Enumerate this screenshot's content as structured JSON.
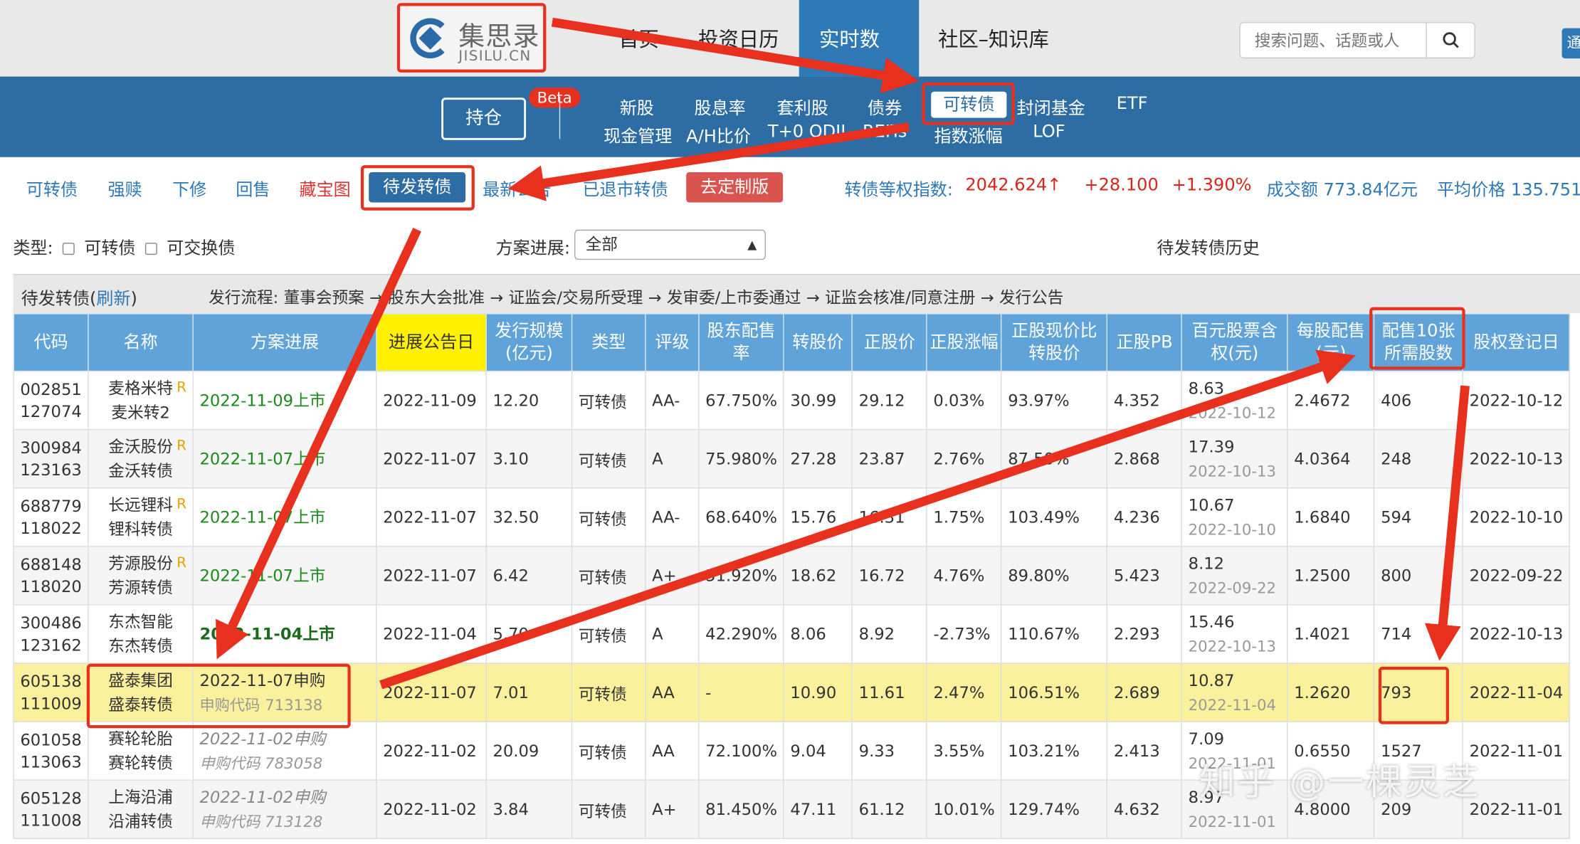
{
  "header": {
    "logo_cn": "集思录",
    "logo_en": "JISILU.CN",
    "nav": [
      "首页",
      "投资日历",
      "实时数据",
      "社区–知识库"
    ],
    "search_placeholder": "搜索问题、话题或人",
    "corner": "通"
  },
  "subnav": {
    "hold": "持仓",
    "beta": "Beta",
    "row1": [
      "新股",
      "股息率",
      "套利股",
      "债券",
      "可转债",
      "封闭基金",
      "ETF"
    ],
    "row2": [
      "现金管理",
      "A/H比价",
      "T+0 QDII",
      "REITs",
      "指数涨幅",
      "LOF"
    ]
  },
  "tabs": {
    "items": [
      "可转债",
      "强赎",
      "下修",
      "回售",
      "藏宝图",
      "待发转债",
      "最新公告",
      "已退市转债"
    ],
    "custom": "去定制版",
    "index_label": "转债等权指数:",
    "index_value": "2042.624↑",
    "change": "+28.100",
    "pct": "+1.390%",
    "volume": "成交额 773.84亿元",
    "avg_price": "平均价格 135.751"
  },
  "filter": {
    "type_label": "类型:",
    "opt1": "可转债",
    "opt2": "可交换债",
    "progress_label": "方案进展:",
    "progress_value": "全部",
    "history_link": "待发转债历史"
  },
  "caption": {
    "title": "待发转债(",
    "refresh": "刷新",
    "title_end": ")",
    "flow": "发行流程:  董事会预案 → 股东大会批准 → 证监会/交易所受理 → 发审委/上市委通过 → 证监会核准/同意注册 → 发行公告"
  },
  "table": {
    "headers": [
      "代码",
      "名称",
      "方案进展",
      "进展公告日",
      "发行规模(亿元)",
      "类型",
      "评级",
      "股东配售率",
      "转股价",
      "正股价",
      "正股涨幅",
      "正股现价比转股价",
      "正股PB",
      "百元股票含权(元)",
      "每股配售(元)",
      "配售10张所需股数",
      "股权登记日"
    ],
    "rows": [
      {
        "code1": "002851",
        "code2": "127074",
        "name1": "麦格米特",
        "name2": "麦米转2",
        "r": "R",
        "prog1": "2022-11-09上市",
        "prog2": "",
        "pstyle": "green",
        "date": "2022-11-09",
        "scale": "12.20",
        "type": "可转债",
        "rating": "AA-",
        "ratio": "67.750%",
        "conv": "30.99",
        "price": "29.12",
        "chg": "0.03%",
        "chgcls": "pos",
        "pv": "93.97%",
        "pb": "4.352",
        "right1": "8.63",
        "right2": "2022-10-12",
        "per": "2.4672",
        "need": "406",
        "reg": "2022-10-12"
      },
      {
        "code1": "300984",
        "code2": "123163",
        "name1": "金沃股份",
        "name2": "金沃转债",
        "r": "R",
        "prog1": "2022-11-07上市",
        "prog2": "",
        "pstyle": "green",
        "date": "2022-11-07",
        "scale": "3.10",
        "type": "可转债",
        "rating": "A",
        "ratio": "75.980%",
        "conv": "27.28",
        "price": "23.87",
        "chg": "2.76%",
        "chgcls": "pos",
        "pv": "87.50%",
        "pb": "2.868",
        "right1": "17.39",
        "right2": "2022-10-13",
        "per": "4.0364",
        "need": "248",
        "reg": "2022-10-13"
      },
      {
        "code1": "688779",
        "code2": "118022",
        "name1": "长远锂科",
        "name2": "锂科转债",
        "r": "R",
        "prog1": "2022-11-07上市",
        "prog2": "",
        "pstyle": "green",
        "date": "2022-11-07",
        "scale": "32.50",
        "type": "可转债",
        "rating": "AA-",
        "ratio": "68.640%",
        "conv": "15.76",
        "price": "16.31",
        "chg": "1.75%",
        "chgcls": "pos",
        "pv": "103.49%",
        "pb": "4.236",
        "right1": "10.67",
        "right2": "2022-10-10",
        "per": "1.6840",
        "need": "594",
        "reg": "2022-10-10"
      },
      {
        "code1": "688148",
        "code2": "118020",
        "name1": "芳源股份",
        "name2": "芳源转债",
        "r": "R",
        "prog1": "2022-11-07上市",
        "prog2": "",
        "pstyle": "green",
        "date": "2022-11-07",
        "scale": "6.42",
        "type": "可转债",
        "rating": "A+",
        "ratio": "51.920%",
        "conv": "18.62",
        "price": "16.72",
        "chg": "4.76%",
        "chgcls": "pos",
        "pv": "89.80%",
        "pb": "5.423",
        "right1": "8.12",
        "right2": "2022-09-22",
        "per": "1.2500",
        "need": "800",
        "reg": "2022-09-22"
      },
      {
        "code1": "300486",
        "code2": "123162",
        "name1": "东杰智能",
        "name2": "东杰转债",
        "r": "",
        "prog1": "2022-11-04上市",
        "prog2": "",
        "pstyle": "bold",
        "date": "2022-11-04",
        "scale": "5.70",
        "type": "可转债",
        "rating": "A",
        "ratio": "42.290%",
        "conv": "8.06",
        "price": "8.92",
        "chg": "-2.73%",
        "chgcls": "neg",
        "pv": "110.67%",
        "pb": "2.293",
        "right1": "15.46",
        "right2": "2022-10-13",
        "per": "1.4021",
        "need": "714",
        "reg": "2022-10-13"
      },
      {
        "code1": "605138",
        "code2": "111009",
        "name1": "盛泰集团",
        "name2": "盛泰转债",
        "r": "",
        "prog1": "2022-11-07申购",
        "prog2": "申购代码 713138",
        "pstyle": "normal",
        "date": "2022-11-07",
        "scale": "7.01",
        "type": "可转债",
        "rating": "AA",
        "ratio": "-",
        "conv": "10.90",
        "price": "11.61",
        "chg": "2.47%",
        "chgcls": "pos",
        "pv": "106.51%",
        "pb": "2.689",
        "right1": "10.87",
        "right2": "2022-11-04",
        "per": "1.2620",
        "need": "793",
        "reg": "2022-11-04"
      },
      {
        "code1": "601058",
        "code2": "113063",
        "name1": "赛轮轮胎",
        "name2": "赛轮转债",
        "r": "",
        "prog1": "2022-11-02申购",
        "prog2": "申购代码 783058",
        "pstyle": "gray",
        "date": "2022-11-02",
        "scale": "20.09",
        "type": "可转债",
        "rating": "AA",
        "ratio": "72.100%",
        "conv": "9.04",
        "price": "9.33",
        "chg": "3.55%",
        "chgcls": "pos",
        "pv": "103.21%",
        "pb": "2.413",
        "right1": "7.09",
        "right2": "2022-11-01",
        "per": "0.6550",
        "need": "1527",
        "reg": "2022-11-01"
      },
      {
        "code1": "605128",
        "code2": "111008",
        "name1": "上海沿浦",
        "name2": "沿浦转债",
        "r": "",
        "prog1": "2022-11-02申购",
        "prog2": "申购代码 713128",
        "pstyle": "gray",
        "date": "2022-11-02",
        "scale": "3.84",
        "type": "可转债",
        "rating": "A+",
        "ratio": "81.450%",
        "conv": "47.11",
        "price": "61.12",
        "chg": "10.01%",
        "chgcls": "pos",
        "pv": "129.74%",
        "pb": "4.632",
        "right1": "8.97",
        "right2": "2022-11-01",
        "per": "4.8000",
        "need": "209",
        "reg": "2022-11-01"
      }
    ]
  },
  "watermark": "知乎 @一棵灵芝",
  "colors": {
    "nav_blue": "#2e6da4",
    "header_blue": "#5fa3d8",
    "highlight_yellow": "#fff100",
    "annotation_red": "#e8301f"
  }
}
